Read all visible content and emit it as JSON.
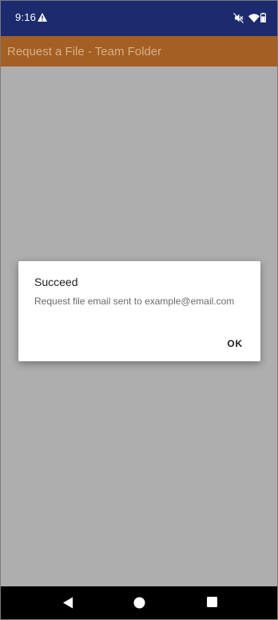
{
  "status_bar": {
    "time": "9:16",
    "icons": [
      "warning-icon",
      "mute-icon",
      "wifi-icon",
      "battery-icon"
    ]
  },
  "app_bar": {
    "title": "Request a File - Team Folder",
    "background_color": "#a35f24"
  },
  "dialog": {
    "title": "Succeed",
    "message": "Request file email sent to example@email.com",
    "ok_label": "OK"
  },
  "nav_bar": {
    "icons": [
      "back-icon",
      "home-icon",
      "recents-icon"
    ]
  },
  "colors": {
    "status_bar": "#1e2a6e",
    "scrim": "#aeaeae",
    "nav_bar": "#000000"
  }
}
